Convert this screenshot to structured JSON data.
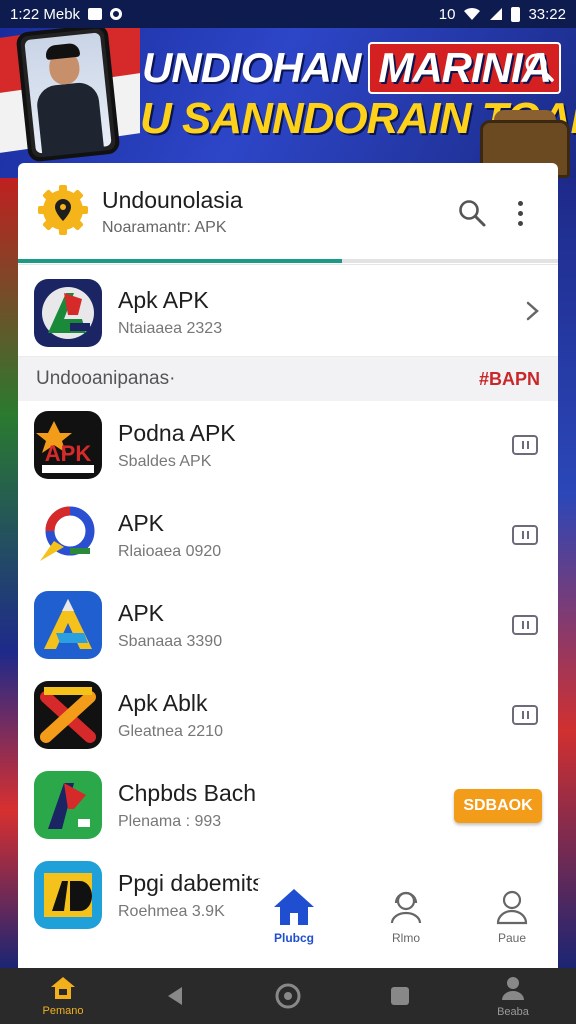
{
  "status_bar": {
    "time_left": "1:22 Mebk",
    "time_right": "33:22",
    "battery": "10"
  },
  "banner": {
    "line1": "UNDIOHAN",
    "line1_accent": "MARINIA",
    "line2": "U SANNDORAIN TOAK."
  },
  "app_header": {
    "title": "Undounolasia",
    "subtitle": "Noaramantr: APK",
    "progress": 0.6
  },
  "featured": {
    "name": "Apk APK",
    "meta": "Ntaiaaea 2323",
    "icon_text": ""
  },
  "section": {
    "title": "Undooanipanas·",
    "tag": "#BAPN"
  },
  "items": [
    {
      "name": "Podna APK",
      "meta": "Sbaldes APK",
      "icon_text": "APK",
      "action": "button"
    },
    {
      "name": "APK",
      "meta": "Rlaioaea 0920",
      "icon_text": "",
      "action": "button"
    },
    {
      "name": "APK",
      "meta": "Sbanaaa 3390",
      "icon_text": "",
      "action": "button"
    },
    {
      "name": "Apk Ablk",
      "meta": "Gleatnea 2210",
      "icon_text": "",
      "action": "button"
    },
    {
      "name": "Chpbds Bach",
      "meta": "Plenama : 993",
      "icon_text": "",
      "action": "SDBAOK"
    },
    {
      "name": "Ppgi dabemits",
      "meta": "Roehmea 3.9K",
      "icon_text": "",
      "action": ""
    }
  ],
  "card_tabs": [
    {
      "label": "Plubcg",
      "icon": "home-icon",
      "active": true
    },
    {
      "label": "Rlmo",
      "icon": "support-icon",
      "active": false
    },
    {
      "label": "Paue",
      "icon": "person-icon",
      "active": false
    }
  ],
  "bottom_nav": [
    {
      "label": "Pemano",
      "icon": "home-icon",
      "active": true
    },
    {
      "label": "",
      "icon": "back-icon",
      "active": false
    },
    {
      "label": "",
      "icon": "home-circle-icon",
      "active": false
    },
    {
      "label": "",
      "icon": "recents-icon",
      "active": false
    },
    {
      "label": "Beaba",
      "icon": "person-icon",
      "active": false
    }
  ],
  "colors": {
    "accent": "#1b9a86",
    "tag": "#c8282a",
    "orange": "#f39c1a",
    "tab_active": "#1f4fd0"
  }
}
